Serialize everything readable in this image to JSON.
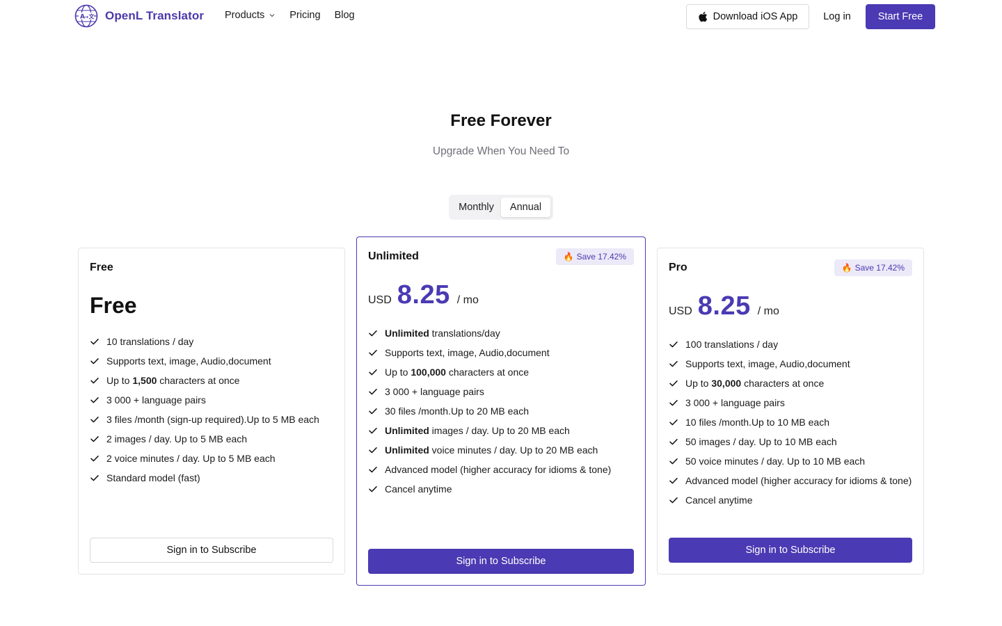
{
  "brand": {
    "name": "OpenL Translator",
    "accent": "#4a3ab3"
  },
  "nav": {
    "items": [
      {
        "label": "Products",
        "has_dropdown": true,
        "icon": "chevron-down-icon"
      },
      {
        "label": "Pricing"
      },
      {
        "label": "Blog"
      }
    ],
    "download_label": "Download iOS App",
    "download_icon": "apple-icon",
    "login_label": "Log in",
    "start_label": "Start Free"
  },
  "hero": {
    "title": "Free Forever",
    "subtitle": "Upgrade When You Need To"
  },
  "billing_toggle": {
    "options": [
      "Monthly",
      "Annual"
    ],
    "selected": "Annual"
  },
  "plans": [
    {
      "name": "Free",
      "price_label": "Free",
      "features": [
        {
          "pre": "10 translations / day",
          "bold": "",
          "post": ""
        },
        {
          "pre": "Supports text, image, Audio,document",
          "bold": "",
          "post": ""
        },
        {
          "pre": "Up to ",
          "bold": "1,500",
          "post": " characters at once"
        },
        {
          "pre": "3 000 + language pairs",
          "bold": "",
          "post": ""
        },
        {
          "pre": "3 files /month (sign-up required).Up to 5 MB each",
          "bold": "",
          "post": ""
        },
        {
          "pre": "2 images / day. Up to 5 MB each",
          "bold": "",
          "post": ""
        },
        {
          "pre": "2 voice minutes / day. Up to 5 MB each",
          "bold": "",
          "post": ""
        },
        {
          "pre": "Standard model (fast)",
          "bold": "",
          "post": ""
        }
      ],
      "cta": "Sign in to Subscribe"
    },
    {
      "name": "Unlimited",
      "badge": "Save 17.42%",
      "badge_icon": "fire-icon",
      "currency": "USD",
      "price": "8.25",
      "period": "/ mo",
      "features": [
        {
          "pre": "",
          "bold": "Unlimited",
          "post": " translations/day"
        },
        {
          "pre": "Supports text, image, Audio,document",
          "bold": "",
          "post": ""
        },
        {
          "pre": "Up to ",
          "bold": "100,000",
          "post": " characters at once"
        },
        {
          "pre": "3 000 + language pairs",
          "bold": "",
          "post": ""
        },
        {
          "pre": "30 files /month.Up to 20 MB each",
          "bold": "",
          "post": ""
        },
        {
          "pre": "",
          "bold": "Unlimited",
          "post": " images / day. Up to 20 MB each"
        },
        {
          "pre": "",
          "bold": "Unlimited",
          "post": " voice minutes / day. Up to 20 MB each"
        },
        {
          "pre": "Advanced model (higher accuracy for idioms & tone)",
          "bold": "",
          "post": ""
        },
        {
          "pre": "Cancel anytime",
          "bold": "",
          "post": ""
        }
      ],
      "cta": "Sign in to Subscribe"
    },
    {
      "name": "Pro",
      "badge": "Save 17.42%",
      "badge_icon": "fire-icon",
      "currency": "USD",
      "price": "8.25",
      "period": "/ mo",
      "features": [
        {
          "pre": "100 translations / day",
          "bold": "",
          "post": ""
        },
        {
          "pre": "Supports text, image, Audio,document",
          "bold": "",
          "post": ""
        },
        {
          "pre": "Up to ",
          "bold": "30,000",
          "post": " characters at once"
        },
        {
          "pre": "3 000 + language pairs",
          "bold": "",
          "post": ""
        },
        {
          "pre": "10 files /month.Up to 10 MB each",
          "bold": "",
          "post": ""
        },
        {
          "pre": "50 images / day. Up to 10 MB each",
          "bold": "",
          "post": ""
        },
        {
          "pre": "50 voice minutes / day. Up to 10 MB each",
          "bold": "",
          "post": ""
        },
        {
          "pre": "Advanced model (higher accuracy for idioms & tone)",
          "bold": "",
          "post": ""
        },
        {
          "pre": "Cancel anytime",
          "bold": "",
          "post": ""
        }
      ],
      "cta": "Sign in to Subscribe"
    }
  ]
}
